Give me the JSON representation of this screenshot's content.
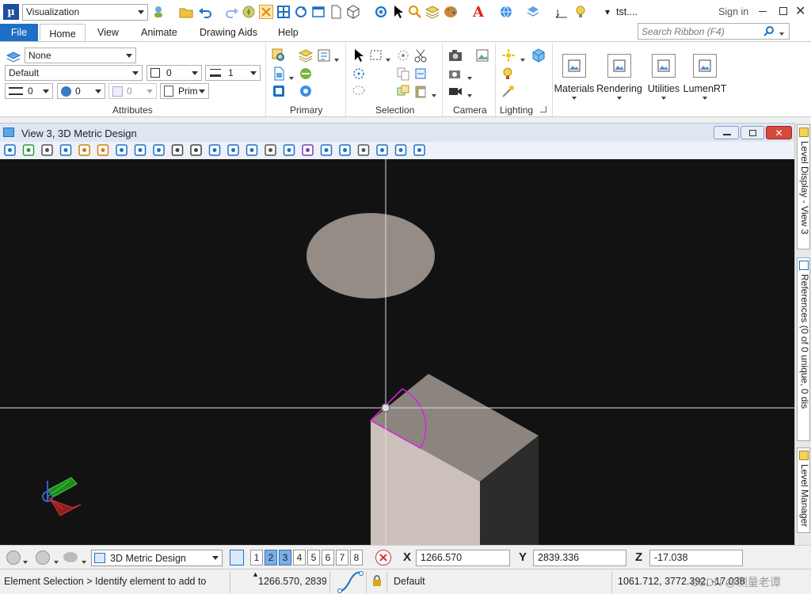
{
  "title_bar": {
    "app_logo": "µ",
    "workflow": "Visualization",
    "file_name": "tst....",
    "sign_in": "Sign in"
  },
  "menu": {
    "tabs": [
      "File",
      "Home",
      "View",
      "Animate",
      "Drawing Aids",
      "Help"
    ],
    "active_tab": "Home",
    "search_placeholder": "Search Ribbon (F4)"
  },
  "ribbon": {
    "attributes": {
      "level": "None",
      "style": "Default",
      "color": "0",
      "weight": "1",
      "line_style": "0",
      "fill_value": "0",
      "transparency": "0",
      "class": "Prim",
      "label": "Attributes"
    },
    "groups": [
      "Primary",
      "Selection",
      "Camera",
      "Lighting"
    ],
    "big_buttons": [
      "Materials",
      "Rendering",
      "Utilities",
      "LumenRT"
    ]
  },
  "view_window": {
    "title": "View 3, 3D Metric Design"
  },
  "right_dock": {
    "tabs": [
      "Level Display - View 3",
      "References (0 of 0 unique, 0 dis",
      "Level Manager"
    ]
  },
  "bottom_toolbar": {
    "model": "3D Metric Design",
    "view_buttons": [
      "1",
      "2",
      "3",
      "4",
      "5",
      "6",
      "7",
      "8"
    ],
    "active_views": [
      "2",
      "3"
    ],
    "x_label": "X",
    "x_value": "1266.570",
    "y_label": "Y",
    "y_value": "2839.336",
    "z_label": "Z",
    "z_value": "-17.038"
  },
  "status_bar": {
    "prompt": "Element Selection > Identify element to add to",
    "cursor_xy": "1266.570, 2839",
    "level": "Default",
    "cursor_xyz": "1061.712, 3772.392, -17.038",
    "watermark": "CSDN @测量老谭"
  },
  "colors": {
    "accent": "#1d70c6",
    "viewport_bg": "#121212",
    "selection_highlight": "#e01fe0"
  }
}
